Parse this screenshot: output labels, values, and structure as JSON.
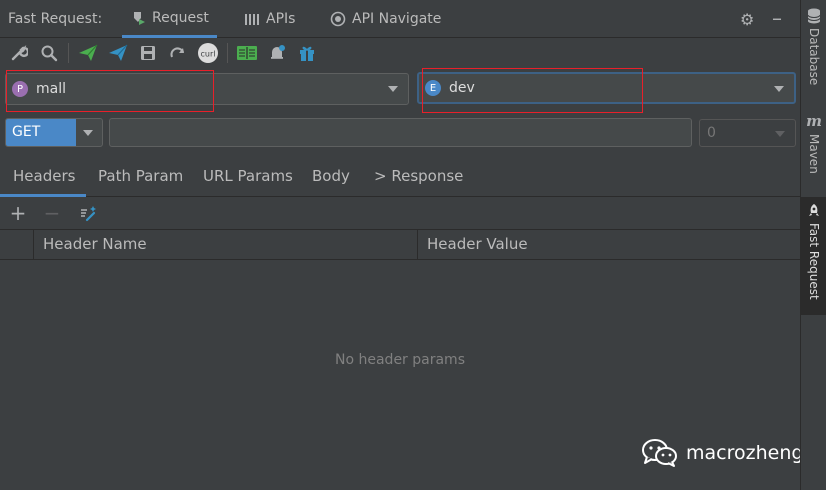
{
  "titlebar": {
    "label": "Fast Request:",
    "tabs": [
      {
        "label": "Request",
        "icon": "request-icon"
      },
      {
        "label": "APIs",
        "icon": "apis-icon"
      },
      {
        "label": "API Navigate",
        "icon": "navigate-icon"
      }
    ]
  },
  "project": {
    "badge": "P",
    "value": "mall",
    "badge_color": "#9a6fb0"
  },
  "environment": {
    "badge": "E",
    "value": "dev",
    "badge_color": "#4a88c7"
  },
  "request": {
    "method": "GET",
    "url": "",
    "count": "0"
  },
  "subtabs": [
    "Headers",
    "Path Param",
    "URL Params",
    "Body",
    "> Response"
  ],
  "table": {
    "columns": [
      "Header Name",
      "Header Value"
    ],
    "empty_text": "No header params"
  },
  "right_strip": [
    "Database",
    "Maven",
    "Fast Request"
  ],
  "watermark": "macrozheng",
  "colors": {
    "accent": "#4a88c7",
    "highlight_box": "#e8202a"
  }
}
